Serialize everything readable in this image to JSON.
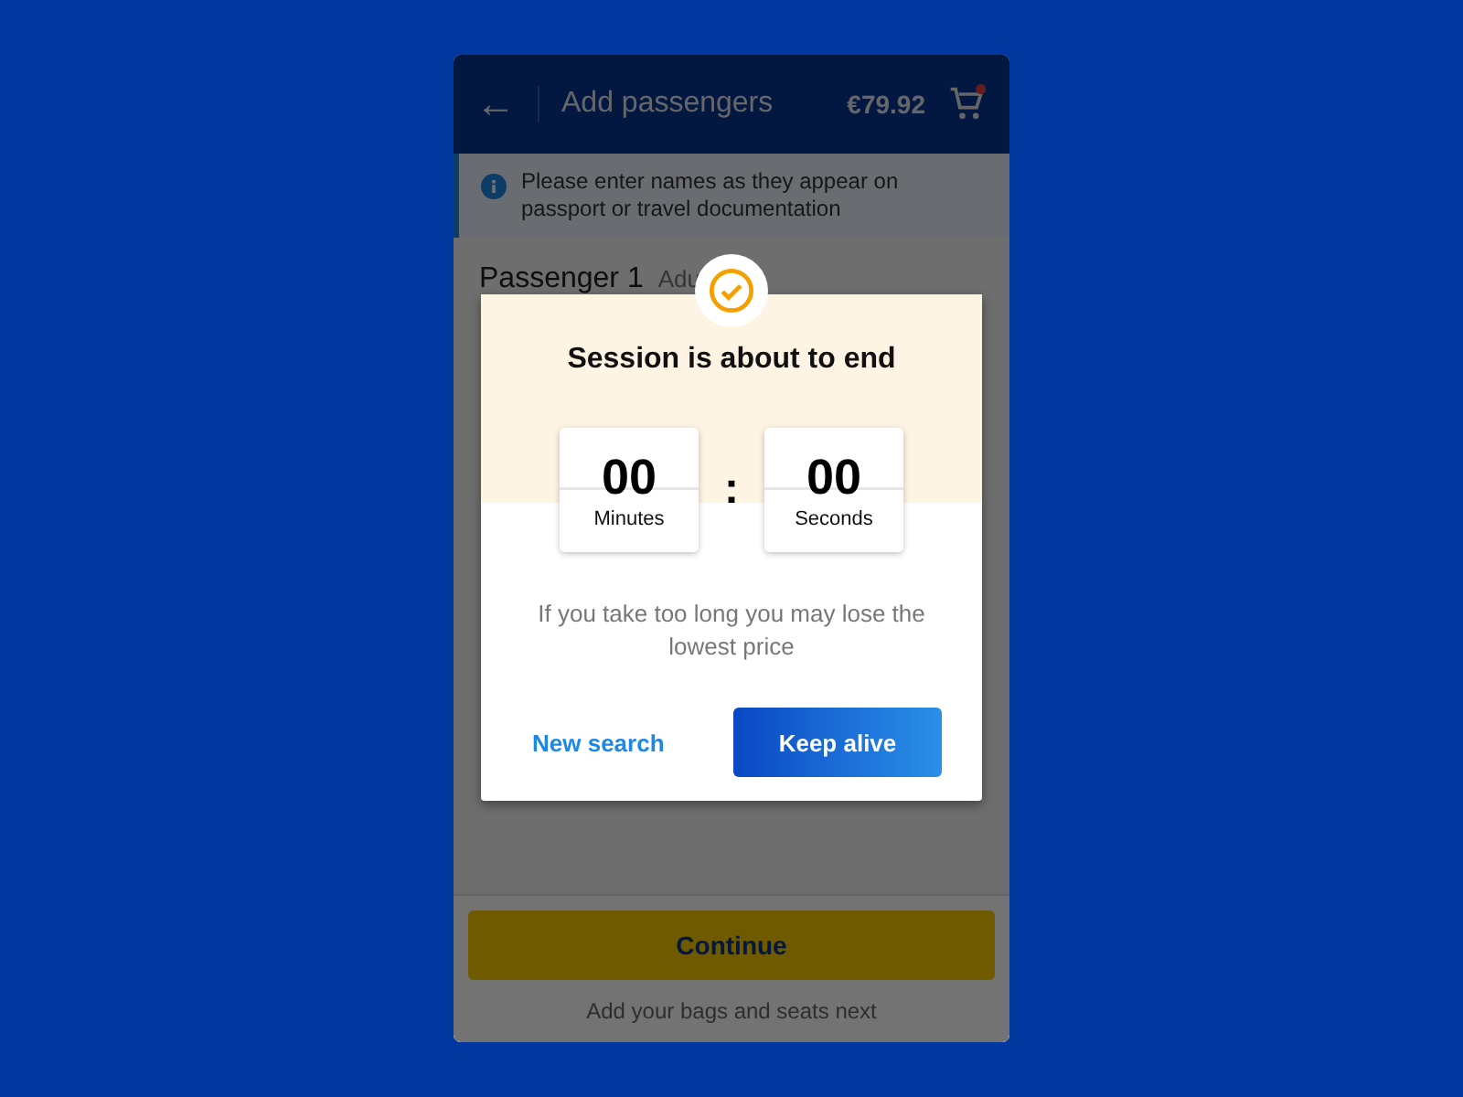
{
  "header": {
    "back_icon": "←",
    "title": "Add passengers",
    "price": "€79.92",
    "cart_badge": true
  },
  "notice": "Please enter names as they appear on passport or travel documentation",
  "passenger": {
    "title": "Passenger 1",
    "type": "Adu"
  },
  "footer": {
    "button": "Continue",
    "hint": "Add your bags and seats next"
  },
  "modal": {
    "title": "Session is about to end",
    "timer": [
      {
        "value": "00",
        "unit": "Minutes"
      },
      {
        "value": "00",
        "unit": "Seconds"
      }
    ],
    "separator": ":",
    "message": "If you take too long you may lose the lowest price",
    "secondary": "New search",
    "primary": "Keep alive"
  }
}
